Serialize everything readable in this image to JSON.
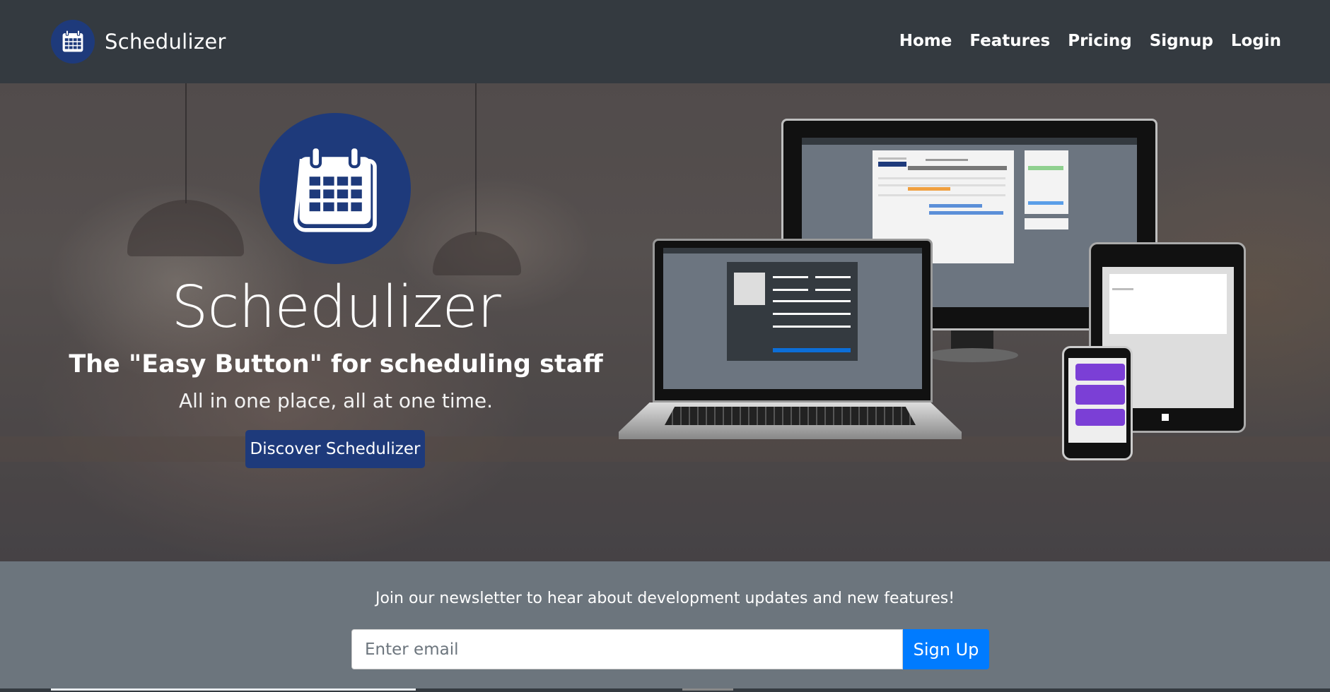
{
  "brand": {
    "name": "Schedulizer",
    "icon": "calendar-icon",
    "color": "#1e3a7b"
  },
  "nav": {
    "items": [
      {
        "label": "Home"
      },
      {
        "label": "Features"
      },
      {
        "label": "Pricing"
      },
      {
        "label": "Signup"
      },
      {
        "label": "Login"
      }
    ]
  },
  "hero": {
    "title": "Schedulizer",
    "subtitle": "The \"Easy Button\" for scheduling staff",
    "tagline": "All in one place, all at one time.",
    "cta_label": "Discover Schedulizer",
    "logo_icon": "calendar-icon",
    "devices_image": "device-mockups-image"
  },
  "newsletter": {
    "text": "Join our newsletter to hear about development updates and new features!",
    "email_placeholder": "Enter email",
    "email_value": "",
    "button_label": "Sign Up",
    "button_color": "#007bff"
  }
}
